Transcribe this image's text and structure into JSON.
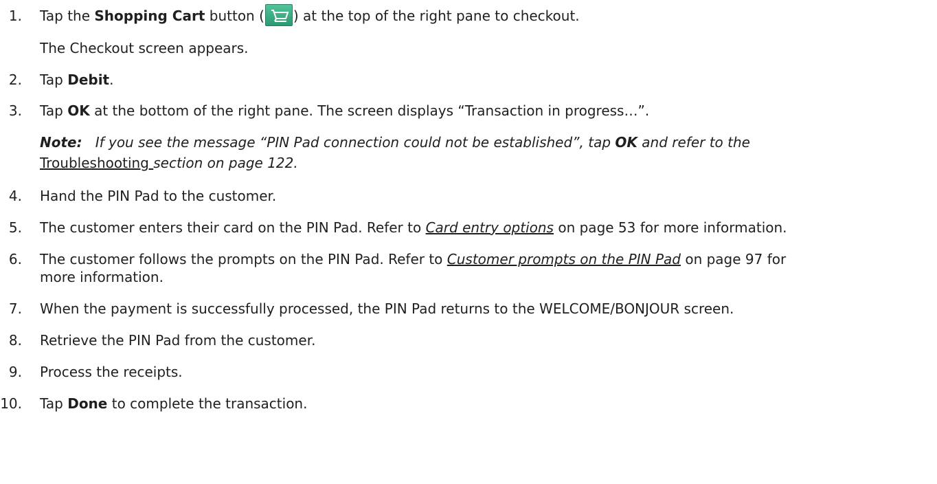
{
  "steps": [
    {
      "num": "1.",
      "pre": "Tap the ",
      "bold": "Shopping Cart",
      "mid": " button (",
      "post": ") at the top of the right pane to checkout.",
      "sub": "The Checkout screen appears."
    },
    {
      "num": "2.",
      "pre": "Tap ",
      "bold": "Debit",
      "post": "."
    },
    {
      "num": "3.",
      "pre": "Tap ",
      "bold": "OK",
      "post": " at the bottom of the right pane. The screen displays “Transaction in progress…”."
    },
    {
      "num": "4.",
      "text": "Hand the PIN Pad to the customer."
    },
    {
      "num": "5.",
      "pre": "The customer enters their card on the PIN Pad. Refer to ",
      "link": "Card entry options",
      "post": " on page 53 for more information."
    },
    {
      "num": "6.",
      "pre": "The customer follows the prompts on the PIN Pad. Refer to ",
      "link": "Customer prompts on the PIN Pad",
      "post": " on page 97 for",
      "line2": "more information."
    },
    {
      "num": "7.",
      "text": "When the payment is successfully processed, the PIN Pad returns to the WELCOME/BONJOUR screen."
    },
    {
      "num": "8.",
      "text": "Retrieve the PIN Pad from the customer."
    },
    {
      "num": "9.",
      "text": "Process the receipts."
    },
    {
      "num": "10.",
      "pre": "Tap ",
      "bold": "Done",
      "post": " to complete the transaction."
    }
  ],
  "note": {
    "label": "Note:",
    "pre": "If you see the message “PIN Pad connection could not be established”, tap ",
    "bold": "OK",
    "mid": " and refer to the",
    "link": "Troubleshooting ",
    "post": "section on page 122."
  },
  "icons": {
    "cart": "shopping-cart-icon"
  },
  "colors": {
    "cart_icon": "#3aae84"
  }
}
